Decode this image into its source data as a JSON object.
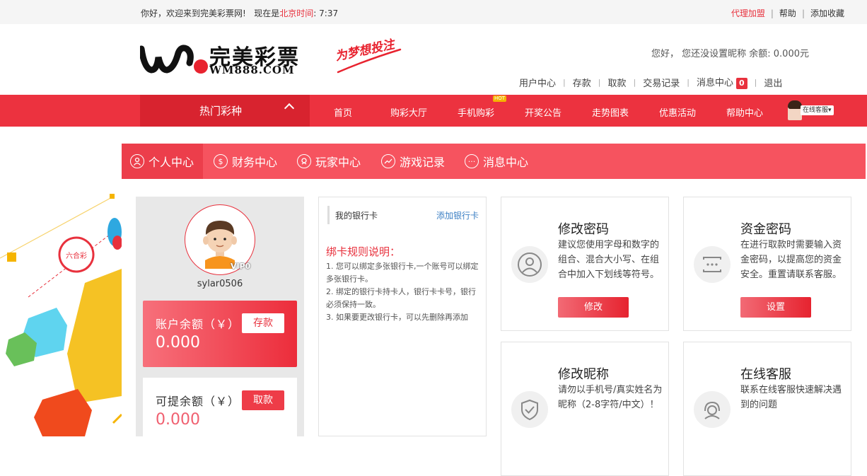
{
  "topbar": {
    "welcome_prefix": "你好，欢迎来到完美彩票网!",
    "time_prefix": "现在是",
    "time_zone": "北京时间",
    "time_value": ": 7:37",
    "links": [
      "代理加盟",
      "帮助",
      "添加收藏"
    ]
  },
  "header": {
    "brand": "完美彩票",
    "domain": "WM888.COM",
    "slogan": "为梦想投注",
    "greeting": "您好，  您还没设置昵称  余额: 0.000元",
    "user_nav": [
      "用户中心",
      "存款",
      "取款",
      "交易记录",
      "消息中心",
      "退出"
    ],
    "message_count": "0"
  },
  "main_nav": {
    "hot_category": "热门彩种",
    "items": [
      "首页",
      "购彩大厅",
      "手机购彩",
      "开奖公告",
      "走势图表",
      "优惠活动",
      "帮助中心"
    ],
    "hot_badge": "HOT",
    "service_label": "在线客服"
  },
  "sub_nav": {
    "items": [
      "个人中心",
      "财务中心",
      "玩家中心",
      "游戏记录",
      "消息中心"
    ]
  },
  "profile": {
    "vip": "VIP0",
    "username": "sylar0506",
    "balance_label": "账户余额（￥）",
    "balance_value": "0.000",
    "deposit_button": "存款",
    "withdrawable_label": "可提余额（￥）",
    "withdrawable_value": "0.000",
    "withdraw_button": "取款"
  },
  "bank": {
    "title": "我的银行卡",
    "add_link": "添加银行卡",
    "rules_title": "绑卡规则说明：",
    "rules": [
      "1. 您可以绑定多张银行卡,一个账号可以绑定多张银行卡。",
      "2. 绑定的银行卡持卡人，银行卡卡号，银行必须保持一致。",
      "3. 如果要更改银行卡，可以先删除再添加"
    ]
  },
  "cards": {
    "password": {
      "title": "修改密码",
      "desc": "建议您使用字母和数字的组合、混合大小写、在组合中加入下划线等符号。",
      "button": "修改"
    },
    "fund_password": {
      "title": "资金密码",
      "desc": "在进行取款时需要输入资金密码，以提高您的资金安全。重置请联系客服。",
      "button": "设置"
    },
    "nickname": {
      "title": "修改昵称",
      "desc": "请勿以手机号/真实姓名为昵称（2-8字符/中文）！"
    },
    "support": {
      "title": "在线客服",
      "desc": "联系在线客服快速解决遇到的问题"
    }
  },
  "deco": {
    "badge_text": "六合彩"
  },
  "colors": {
    "brand_red": "#ec323f",
    "dark_red": "#d8232f",
    "subnav": "#f6535f",
    "link_blue": "#3b7fc4"
  }
}
